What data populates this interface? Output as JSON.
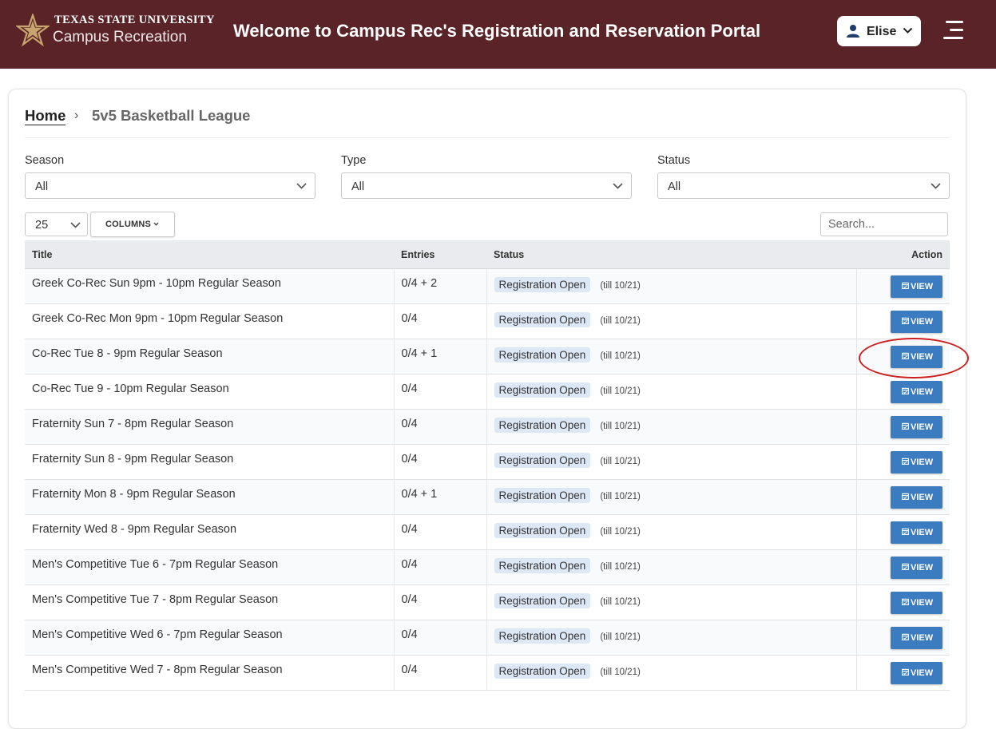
{
  "header": {
    "university": "TEXAS STATE UNIVERSITY",
    "department": "Campus Recreation",
    "title": "Welcome to Campus Rec's Registration and Reservation Portal",
    "user_name": "Elise",
    "brand_color": "#5a2328"
  },
  "breadcrumb": {
    "home": "Home",
    "current": "5v5 Basketball League"
  },
  "filters": {
    "season": {
      "label": "Season",
      "value": "All"
    },
    "type": {
      "label": "Type",
      "value": "All"
    },
    "status": {
      "label": "Status",
      "value": "All"
    }
  },
  "toolbar": {
    "page_size": "25",
    "columns_label": "COLUMNS",
    "search_placeholder": "Search..."
  },
  "table": {
    "columns": [
      "Title",
      "Entries",
      "Status",
      "Action"
    ],
    "view_label": "VIEW",
    "rows": [
      {
        "title": "Greek Co-Rec Sun 9pm - 10pm Regular Season",
        "entries": "0/4 + 2",
        "status": "Registration Open",
        "till": "(till 10/21)"
      },
      {
        "title": "Greek Co-Rec Mon 9pm - 10pm Regular Season",
        "entries": "0/4",
        "status": "Registration Open",
        "till": "(till 10/21)"
      },
      {
        "title": "Co-Rec Tue 8 - 9pm Regular Season",
        "entries": "0/4 + 1",
        "status": "Registration Open",
        "till": "(till 10/21)"
      },
      {
        "title": "Co-Rec Tue 9 - 10pm Regular Season",
        "entries": "0/4",
        "status": "Registration Open",
        "till": "(till 10/21)"
      },
      {
        "title": "Fraternity Sun 7 - 8pm Regular Season",
        "entries": "0/4",
        "status": "Registration Open",
        "till": "(till 10/21)"
      },
      {
        "title": "Fraternity Sun 8 - 9pm Regular Season",
        "entries": "0/4",
        "status": "Registration Open",
        "till": "(till 10/21)"
      },
      {
        "title": "Fraternity Mon 8 - 9pm Regular Season",
        "entries": "0/4 + 1",
        "status": "Registration Open",
        "till": "(till 10/21)"
      },
      {
        "title": "Fraternity Wed 8 - 9pm Regular Season",
        "entries": "0/4",
        "status": "Registration Open",
        "till": "(till 10/21)"
      },
      {
        "title": "Men's Competitive Tue 6 - 7pm Regular Season",
        "entries": "0/4",
        "status": "Registration Open",
        "till": "(till 10/21)"
      },
      {
        "title": "Men's Competitive Tue 7 - 8pm Regular Season",
        "entries": "0/4",
        "status": "Registration Open",
        "till": "(till 10/21)"
      },
      {
        "title": "Men's Competitive Wed 6 - 7pm Regular Season",
        "entries": "0/4",
        "status": "Registration Open",
        "till": "(till 10/21)"
      },
      {
        "title": "Men's Competitive Wed 7 - 8pm Regular Season",
        "entries": "0/4",
        "status": "Registration Open",
        "till": "(till 10/21)"
      }
    ]
  }
}
